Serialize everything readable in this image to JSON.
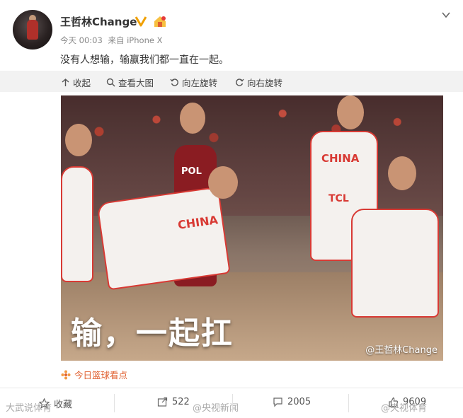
{
  "post": {
    "username": "王哲林Change",
    "time": "今天 00:03",
    "source": "来自 iPhone X",
    "text": "没有人想输，输赢我们都一直在一起。"
  },
  "actions": {
    "collapse": "收起",
    "view_large": "查看大图",
    "rotate_left": "向左旋转",
    "rotate_right": "向右旋转"
  },
  "image": {
    "overlay_text": "输，一起扛",
    "watermark": "@王哲林Change",
    "jersey_text": [
      "CHINA",
      "POL",
      "TCL"
    ]
  },
  "topic": "今日篮球看点",
  "bottom": {
    "favorite": "收藏",
    "repost_count": "522",
    "comment_count": "2005",
    "like_count": "9609"
  },
  "watermarks": {
    "left": "大武说体育",
    "mid": "@央视新闻",
    "right": "@央视体育"
  },
  "colors": {
    "accent_orange": "#e06030",
    "verified_gold": "#f0a000",
    "jersey_red": "#d83a34"
  },
  "icons": [
    "avatar",
    "verified-icon",
    "vip-icon",
    "chevron-down-icon",
    "collapse-icon",
    "search-icon",
    "rotate-left-icon",
    "rotate-right-icon",
    "topic-icon",
    "star-icon",
    "repost-icon",
    "comment-icon",
    "like-icon"
  ]
}
